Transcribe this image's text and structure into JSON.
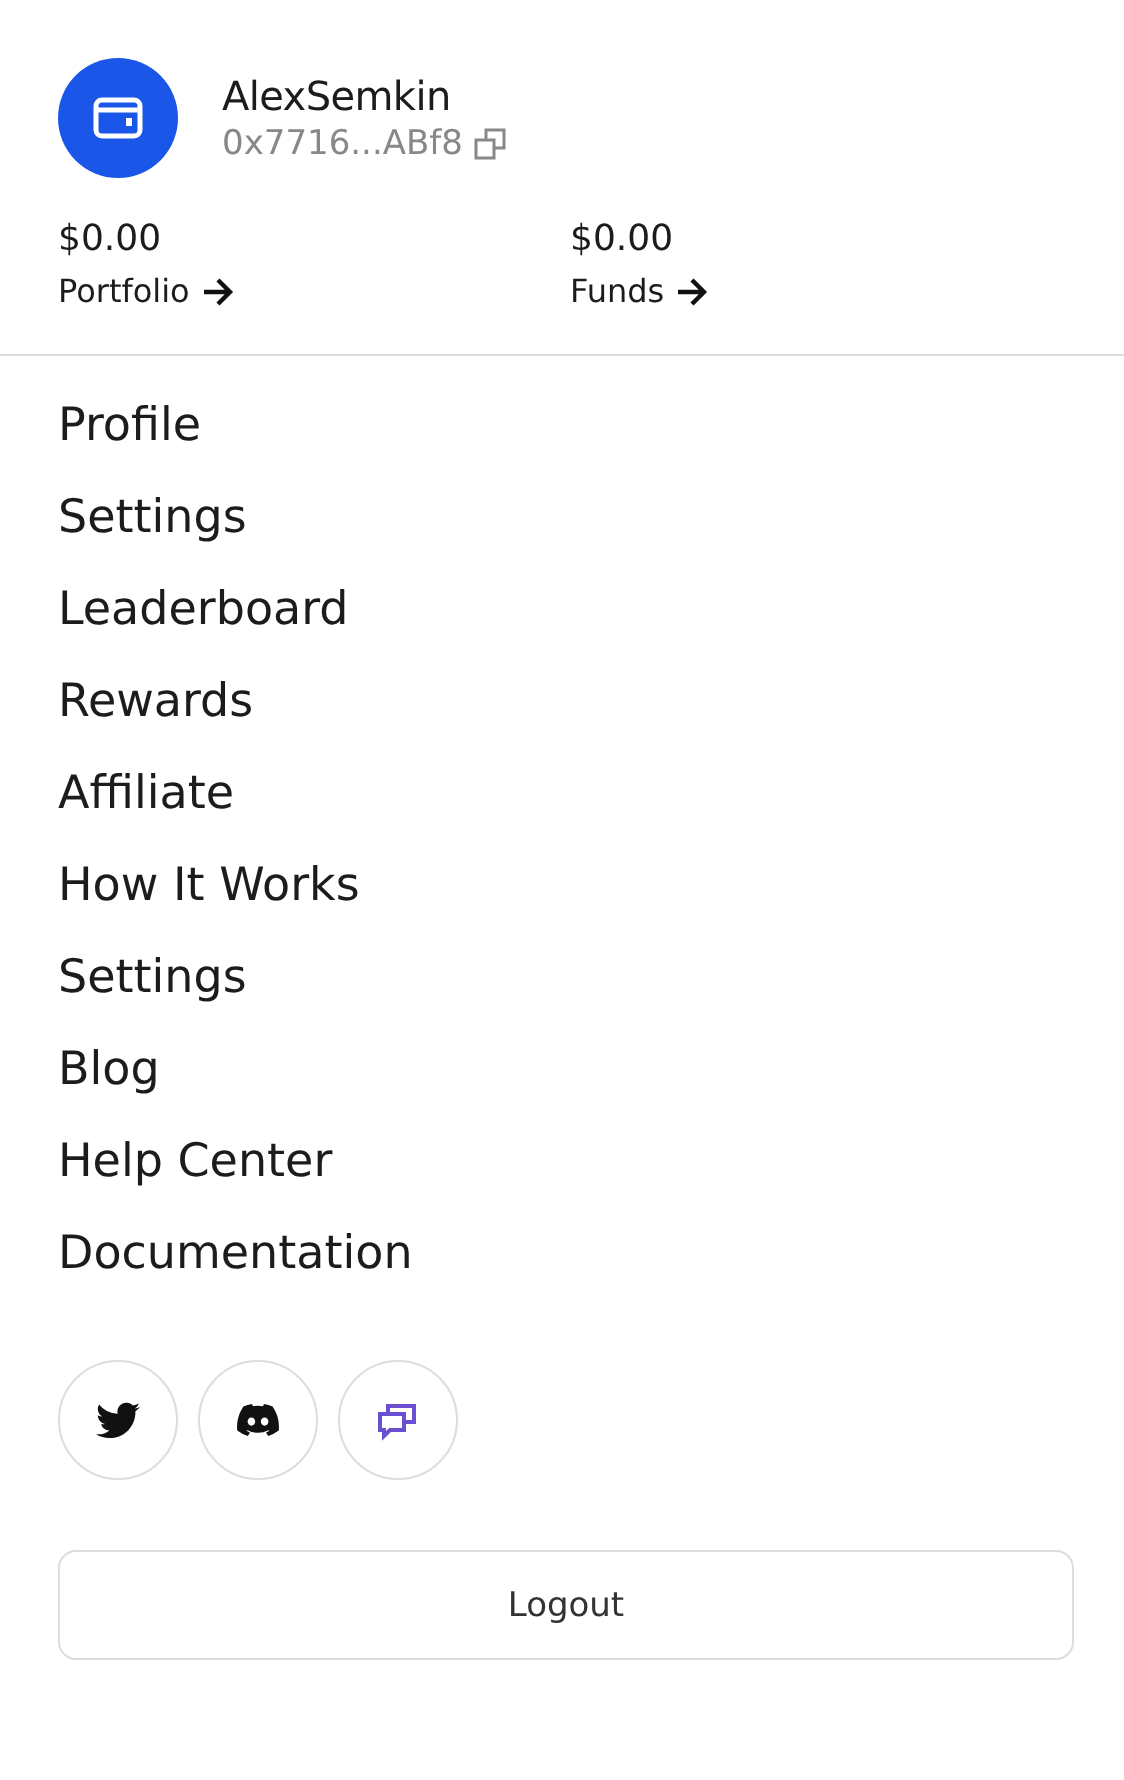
{
  "account": {
    "name": "AlexSemkin",
    "address": "0x7716...ABf8"
  },
  "balances": [
    {
      "amount": "$0.00",
      "label": "Portfolio"
    },
    {
      "amount": "$0.00",
      "label": "Funds"
    }
  ],
  "menu": [
    "Profile",
    "Settings",
    "Leaderboard",
    "Rewards",
    "Affiliate",
    "How It Works",
    "Settings",
    "Blog",
    "Help Center",
    "Documentation"
  ],
  "social": [
    {
      "kind": "bird"
    },
    {
      "kind": "controller"
    },
    {
      "kind": "chat"
    }
  ],
  "logout": "Logout"
}
